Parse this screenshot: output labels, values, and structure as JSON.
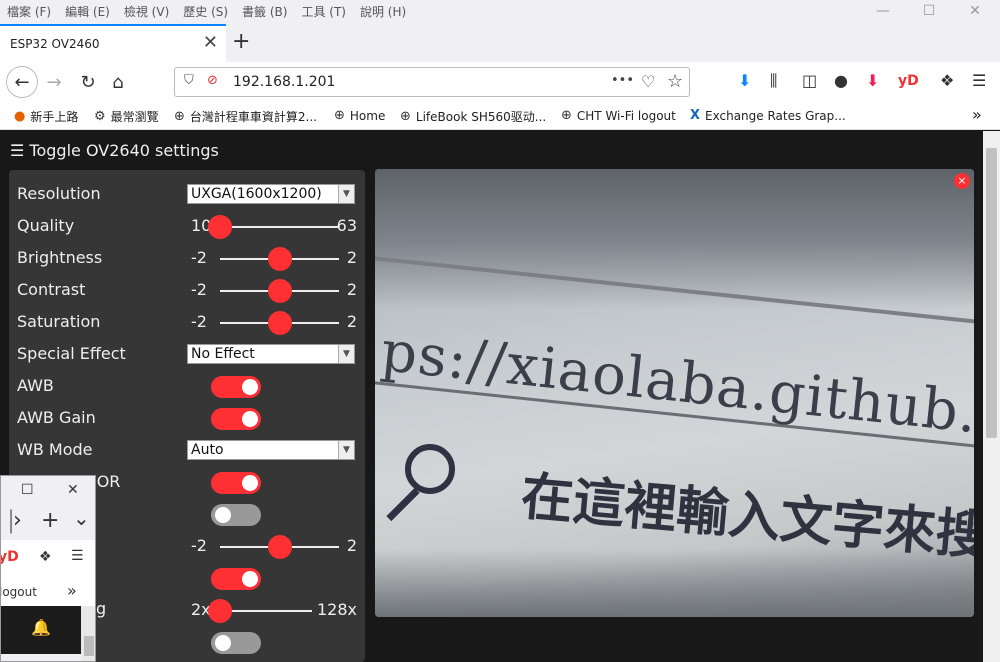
{
  "menubar": {
    "items": [
      "檔案 (F)",
      "編輯 (E)",
      "檢視 (V)",
      "歷史 (S)",
      "書籤 (B)",
      "工具 (T)",
      "說明 (H)"
    ],
    "minimize": "—",
    "maximize": "☐",
    "close": "✕"
  },
  "tab": {
    "title": "ESP32 OV2460",
    "close": "✕",
    "new": "+"
  },
  "nav": {
    "back": "←",
    "forward": "→",
    "reload": "↻",
    "home": "⌂",
    "url": "192.168.1.201",
    "more": "•••",
    "pocket": "♡",
    "star": "☆",
    "download": "⬇",
    "library": "⫼",
    "sidebar": "◫",
    "account": "●",
    "ext1": "⬇",
    "ext2": "yD",
    "ext3": "❖",
    "menu": "☰"
  },
  "bookmarks": [
    {
      "icon": "firefox-icon",
      "glyph": "●",
      "label": "新手上路"
    },
    {
      "icon": "gear-icon",
      "glyph": "⚙",
      "label": "最常瀏覽"
    },
    {
      "icon": "globe-icon",
      "glyph": "⊕",
      "label": "台灣計程車車資計算2..."
    },
    {
      "icon": "globe-icon",
      "glyph": "⊕",
      "label": "Home"
    },
    {
      "icon": "globe-icon",
      "glyph": "⊕",
      "label": "LifeBook SH560驱动..."
    },
    {
      "icon": "globe-icon",
      "glyph": "⊕",
      "label": "CHT Wi-Fi logout"
    },
    {
      "icon": "x-icon",
      "glyph": "X",
      "label": "Exchange Rates Grap..."
    }
  ],
  "bookmarks_overflow": "»",
  "page": {
    "toggle_label": "☰ Toggle OV2640 settings",
    "settings": [
      {
        "label": "Resolution",
        "type": "select",
        "value": "UXGA(1600x1200)"
      },
      {
        "label": "Quality",
        "type": "range",
        "min": "10",
        "max": "63",
        "level": 0.0
      },
      {
        "label": "Brightness",
        "type": "range",
        "min": "-2",
        "max": "2",
        "level": 0.5
      },
      {
        "label": "Contrast",
        "type": "range",
        "min": "-2",
        "max": "2",
        "level": 0.5
      },
      {
        "label": "Saturation",
        "type": "range",
        "min": "-2",
        "max": "2",
        "level": 0.5
      },
      {
        "label": "Special Effect",
        "type": "select",
        "value": "No Effect"
      },
      {
        "label": "AWB",
        "type": "toggle",
        "on": true
      },
      {
        "label": "AWB Gain",
        "type": "toggle",
        "on": true
      },
      {
        "label": "WB Mode",
        "type": "select",
        "value": "Auto"
      },
      {
        "label": "AEC SENSOR",
        "type": "toggle",
        "on": true
      },
      {
        "label": "",
        "type": "toggle",
        "on": false
      },
      {
        "label": "",
        "type": "range",
        "min": "-2",
        "max": "2",
        "level": 0.5
      },
      {
        "label": "",
        "type": "toggle",
        "on": true
      },
      {
        "label": "",
        "type": "range",
        "min": "2x",
        "max": "128x",
        "level": 0.0
      },
      {
        "label": "",
        "type": "toggle",
        "on": false
      }
    ],
    "stream": {
      "url_text": "ps://xiaolaba.github.io",
      "cn_text": "在這裡輸入文字來搜",
      "close": "×"
    }
  },
  "miniwin": {
    "maximize": "☐",
    "close": "✕",
    "chev": "›",
    "plus": "+",
    "down": "⌄",
    "yd": "yD",
    "ext": "❖",
    "menu": "☰",
    "bm": "logout",
    "overflow": "»",
    "bell": "🔔",
    "row_label_tail": "g"
  }
}
